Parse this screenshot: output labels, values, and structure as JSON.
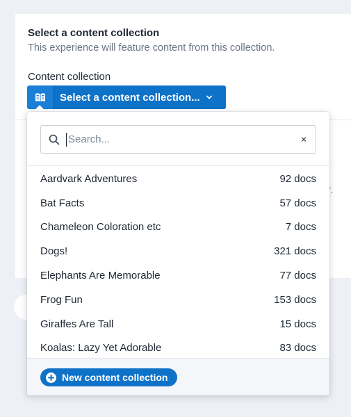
{
  "section": {
    "title": "Select a content collection",
    "subtitle": "This experience will feature content from this collection."
  },
  "field": {
    "label": "Content collection",
    "selector_label": "Select a content collection...",
    "selector_icon": "book-icon",
    "chevron_icon": "chevron-down-icon"
  },
  "background_peek": {
    "text": "y for."
  },
  "dropdown": {
    "search_placeholder": "Search...",
    "search_value": "",
    "clear_label": "×",
    "items": [
      {
        "name": "Aardvark Adventures",
        "count": "92 docs"
      },
      {
        "name": "Bat Facts",
        "count": "57 docs"
      },
      {
        "name": "Chameleon Coloration etc",
        "count": "7 docs"
      },
      {
        "name": "Dogs!",
        "count": "321 docs"
      },
      {
        "name": "Elephants Are Memorable",
        "count": "77 docs"
      },
      {
        "name": "Frog Fun",
        "count": "153 docs"
      },
      {
        "name": "Giraffes Are Tall",
        "count": "15 docs"
      },
      {
        "name": "Koalas: Lazy Yet Adorable",
        "count": "83 docs"
      }
    ],
    "footer_button": "New content collection"
  },
  "colors": {
    "accent": "#0f72c9",
    "background": "#edf0f5"
  }
}
